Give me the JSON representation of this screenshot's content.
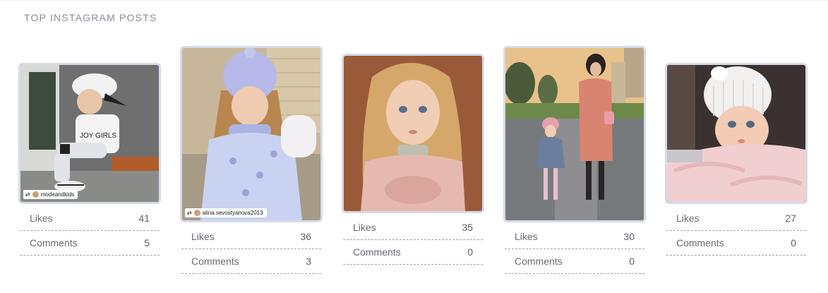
{
  "panel": {
    "title": "TOP INSTAGRAM POSTS"
  },
  "labels": {
    "likes": "Likes",
    "comments": "Comments"
  },
  "posts": [
    {
      "likes": "41",
      "comments": "5",
      "tag": "modeandkids"
    },
    {
      "likes": "36",
      "comments": "3",
      "tag": "alina.sevostyanova2013"
    },
    {
      "likes": "35",
      "comments": "0"
    },
    {
      "likes": "30",
      "comments": "0"
    },
    {
      "likes": "27",
      "comments": "0"
    }
  ],
  "colors": {
    "card_border": "#d5dbe8",
    "divider": "#9aa0ad",
    "title": "#8a8d98"
  }
}
